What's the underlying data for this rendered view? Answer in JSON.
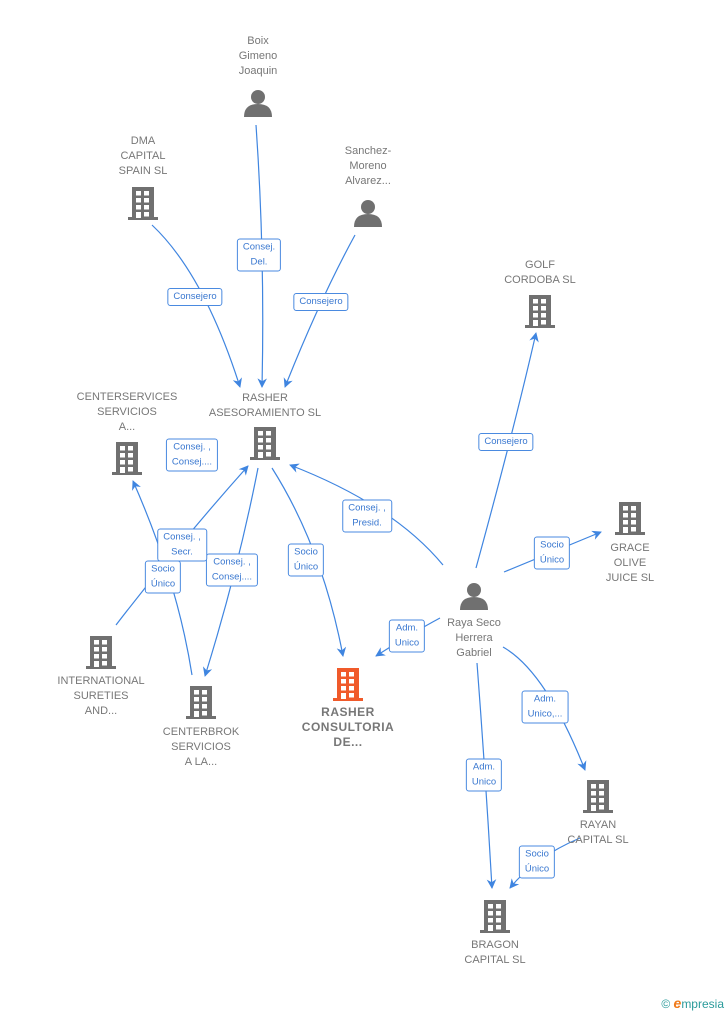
{
  "colors": {
    "edge": "#3f85e0",
    "node": "#707070",
    "highlight": "#f05a2a"
  },
  "nodes": [
    {
      "id": "boix",
      "type": "person-icon",
      "lines": [
        "Boix",
        "Gimeno",
        "Joaquin"
      ]
    },
    {
      "id": "dma",
      "type": "building-icon",
      "lines": [
        "DMA",
        "CAPITAL",
        "SPAIN  SL"
      ]
    },
    {
      "id": "sanchez",
      "type": "person-icon",
      "lines": [
        "Sanchez-",
        "Moreno",
        "Alvarez..."
      ]
    },
    {
      "id": "golf",
      "type": "building-icon",
      "lines": [
        "GOLF",
        "CORDOBA  SL"
      ]
    },
    {
      "id": "rasher_ases",
      "type": "building-icon",
      "lines": [
        "RASHER",
        "ASESORAMIENTO SL"
      ]
    },
    {
      "id": "centerservices",
      "type": "building-icon",
      "lines": [
        "CENTERSERVICES",
        "SERVICIOS",
        "A..."
      ]
    },
    {
      "id": "grace",
      "type": "building-icon",
      "lines": [
        "GRACE",
        "OLIVE",
        "JUICE  SL"
      ]
    },
    {
      "id": "raya",
      "type": "person-icon",
      "lines": [
        "Raya Seco",
        "Herrera",
        "Gabriel"
      ]
    },
    {
      "id": "international",
      "type": "building-icon",
      "lines": [
        "INTERNATIONAL",
        "SURETIES",
        "AND..."
      ]
    },
    {
      "id": "centerbrok",
      "type": "building-icon",
      "lines": [
        "CENTERBROK",
        "SERVICIOS",
        "A LA..."
      ]
    },
    {
      "id": "rasher_cons",
      "type": "building-icon",
      "main": true,
      "lines": [
        "RASHER",
        "CONSULTORIA",
        "DE..."
      ]
    },
    {
      "id": "rayan",
      "type": "building-icon",
      "lines": [
        "RAYAN",
        "CAPITAL  SL"
      ]
    },
    {
      "id": "bragon",
      "type": "building-icon",
      "lines": [
        "BRAGON",
        "CAPITAL  SL"
      ]
    }
  ],
  "edges": [
    {
      "from": "boix",
      "to": "rasher_ases",
      "label": [
        "Consej.",
        "Del."
      ]
    },
    {
      "from": "dma",
      "to": "rasher_ases",
      "label": [
        "Consejero"
      ]
    },
    {
      "from": "sanchez",
      "to": "rasher_ases",
      "label": [
        "Consejero"
      ]
    },
    {
      "from": "raya",
      "to": "golf",
      "label": [
        "Consejero"
      ]
    },
    {
      "from": "raya",
      "to": "rasher_ases",
      "label": [
        "Consej. ,",
        "Presid."
      ]
    },
    {
      "from": "raya",
      "to": "grace",
      "label": [
        "Socio",
        "Único"
      ]
    },
    {
      "from": "raya",
      "to": "rasher_cons",
      "label": [
        "Adm.",
        "Unico"
      ]
    },
    {
      "from": "raya",
      "to": "rayan",
      "label": [
        "Adm.",
        "Unico,..."
      ]
    },
    {
      "from": "raya",
      "to": "bragon",
      "label": [
        "Adm.",
        "Unico"
      ]
    },
    {
      "from": "rayan",
      "to": "bragon",
      "label": [
        "Socio",
        "Único"
      ]
    },
    {
      "from": "rasher_ases",
      "to": "rasher_cons",
      "label": [
        "Socio",
        "Único"
      ]
    },
    {
      "from": "rasher_ases",
      "to": "centerbrok",
      "label": [
        "Consej. ,",
        "Consej...."
      ]
    },
    {
      "from": "international",
      "to": "rasher_ases",
      "label": [
        "Consej. ,",
        "Secr."
      ]
    },
    {
      "from": "centerbrok",
      "to": "centerservices",
      "label": [
        "Socio",
        "Único"
      ]
    },
    {
      "from": "centerservices",
      "to": "rasher_ases",
      "label": [
        "Consej. ,",
        "Consej...."
      ]
    }
  ],
  "footer": {
    "copyright": "©",
    "brand_e": "e",
    "brand_rest": "mpresia"
  }
}
